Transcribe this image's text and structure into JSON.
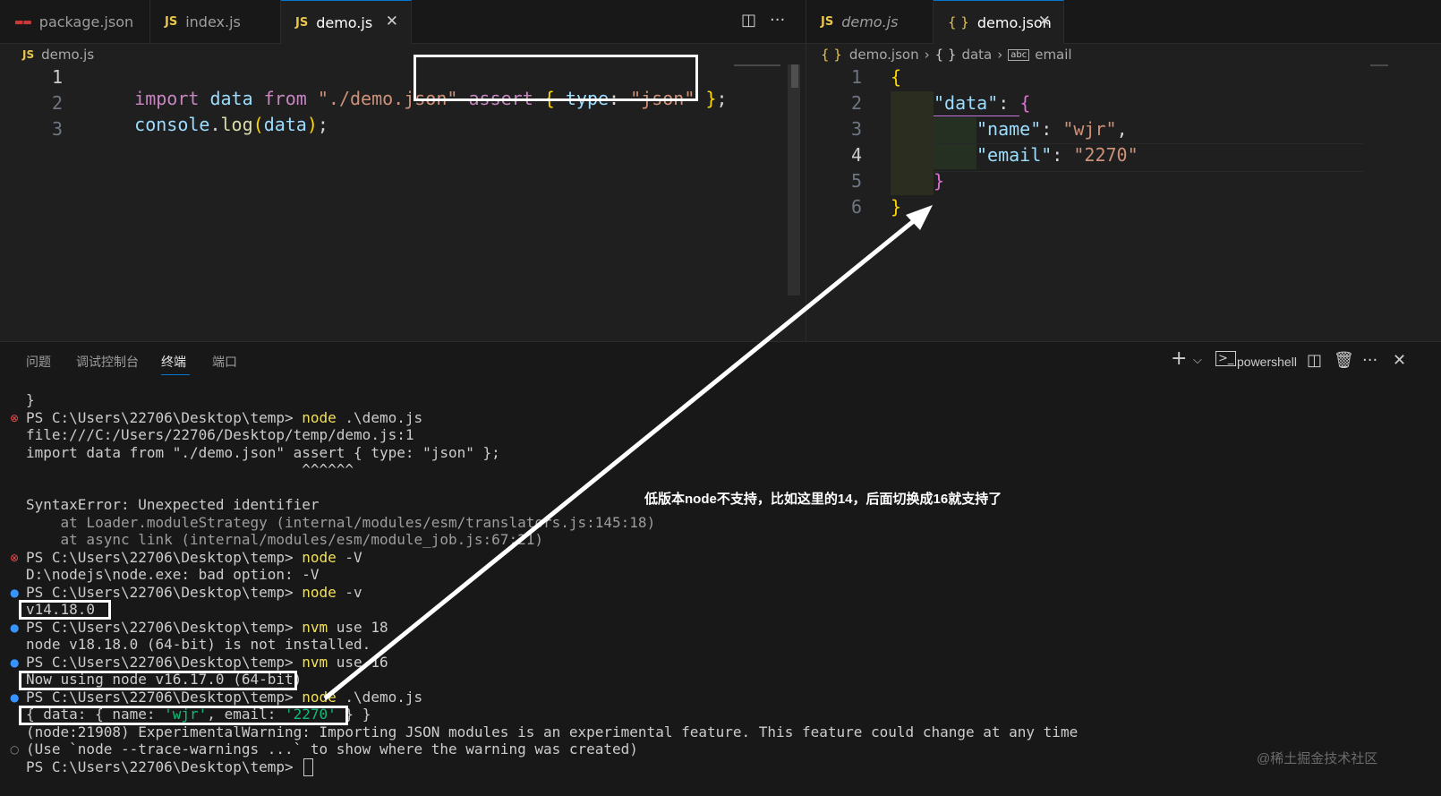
{
  "left_tabs": [
    {
      "label": "package.json",
      "icon": "npm-icon"
    },
    {
      "label": "index.js",
      "icon": "JS"
    },
    {
      "label": "demo.js",
      "icon": "JS",
      "active": true
    }
  ],
  "right_tabs": [
    {
      "label": "demo.js",
      "icon": "JS"
    },
    {
      "label": "demo.json",
      "icon": "{ }",
      "active": true
    }
  ],
  "left_breadcrumb": {
    "icon": "JS",
    "file": "demo.js"
  },
  "right_breadcrumb": {
    "icon": "{ }",
    "file": "demo.json",
    "seg2_icon": "{ }",
    "seg2": "data",
    "seg3_icon": "abc",
    "seg3": "email"
  },
  "left_editor": {
    "line_numbers": [
      "1",
      "2",
      "3"
    ],
    "line1": {
      "t1": "import",
      "t2": " data ",
      "t3": "from",
      "t4": " ",
      "t5": "\"./demo.json\"",
      "t6": " ",
      "t7": "assert",
      "t8": " ",
      "t9": "{",
      "t10": " type",
      "t11": ": ",
      "t12": "\"json\"",
      "t13": " ",
      "t14": "}",
      "t15": ";"
    },
    "line2": {
      "t1": "console",
      "t2": ".",
      "t3": "log",
      "t4": "(",
      "t5": "data",
      "t6": ")",
      "t7": ";"
    }
  },
  "right_editor": {
    "line_numbers": [
      "1",
      "2",
      "3",
      "4",
      "5",
      "6"
    ],
    "l1": "{",
    "l2_key": "\"data\"",
    "l2_colon": ": ",
    "l2_brace": "{",
    "l3_key": "\"name\"",
    "l3_colon": ": ",
    "l3_val": "\"wjr\"",
    "l3_comma": ",",
    "l4_key": "\"email\"",
    "l4_colon": ": ",
    "l4_val": "\"2270\"",
    "l5": "}",
    "l6": "}"
  },
  "panel": {
    "tabs": [
      "问题",
      "调试控制台",
      "终端",
      "端口"
    ],
    "shell_label": "powershell",
    "plus": "+",
    "chevron": "⌵",
    "more": "···",
    "close": "✕"
  },
  "terminal": [
    {
      "deco": "",
      "text": "}"
    },
    {
      "deco": "err",
      "prompt": "PS C:\\Users\\22706\\Desktop\\temp> ",
      "cmd": "node",
      "args": " .\\demo.js"
    },
    {
      "deco": "",
      "text": "file:///C:/Users/22706/Desktop/temp/demo.js:1"
    },
    {
      "deco": "",
      "text": "import data from \"./demo.json\" assert { type: \"json\" };"
    },
    {
      "deco": "",
      "text": "                                ^^^^^^"
    },
    {
      "deco": "",
      "text": ""
    },
    {
      "deco": "",
      "text": "SyntaxError: Unexpected identifier"
    },
    {
      "deco": "",
      "dim": "    at Loader.moduleStrategy (internal/modules/esm/translators.js:145:18)"
    },
    {
      "deco": "",
      "dim": "    at async link (internal/modules/esm/module_job.js:67:21)"
    },
    {
      "deco": "err",
      "prompt": "PS C:\\Users\\22706\\Desktop\\temp> ",
      "cmd": "node",
      "args": " -V"
    },
    {
      "deco": "",
      "text": "D:\\nodejs\\node.exe: bad option: -V"
    },
    {
      "deco": "ok",
      "prompt": "PS C:\\Users\\22706\\Desktop\\temp> ",
      "cmd": "node",
      "args": " -v"
    },
    {
      "deco": "",
      "text": "v14.18.0"
    },
    {
      "deco": "ok",
      "prompt": "PS C:\\Users\\22706\\Desktop\\temp> ",
      "cmd": "nvm",
      "args": " use 18"
    },
    {
      "deco": "",
      "text": "node v18.18.0 (64-bit) is not installed."
    },
    {
      "deco": "ok",
      "prompt": "PS C:\\Users\\22706\\Desktop\\temp> ",
      "cmd": "nvm",
      "args": " use 16"
    },
    {
      "deco": "",
      "text": "Now using node v16.17.0 (64-bit)"
    },
    {
      "deco": "ok",
      "prompt": "PS C:\\Users\\22706\\Desktop\\temp> ",
      "cmd": "node",
      "args": " .\\demo.js"
    },
    {
      "deco": "",
      "out": true,
      "p1": "{ data: { name: ",
      "p2": "'wjr'",
      "p3": ", email: ",
      "p4": "'2270'",
      "p5": " } }"
    },
    {
      "deco": "",
      "text": "(node:21908) ExperimentalWarning: Importing JSON modules is an experimental feature. This feature could change at any time"
    },
    {
      "deco": "none",
      "text": "(Use `node --trace-warnings ...` to show where the warning was created)"
    },
    {
      "deco": "",
      "prompt": "PS C:\\Users\\22706\\Desktop\\temp> ",
      "cursor": true
    }
  ],
  "annotation_note": "低版本node不支持，比如这里的14，后面切换成16就支持了",
  "watermark": "@稀土掘金技术社区",
  "colors": {
    "annotation": "#ffffff",
    "accent": "#0078d4",
    "js_icon": "#e8c64d"
  }
}
